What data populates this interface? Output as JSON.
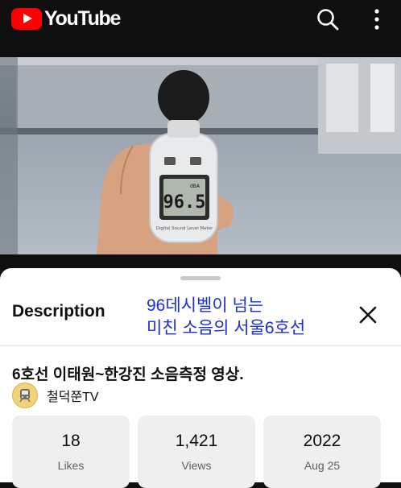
{
  "header": {
    "logo_text": "YouTube",
    "brand_color": "#ff0000",
    "search_icon": "search-icon",
    "menu_icon": "more-vert-icon"
  },
  "player": {
    "meter_reading": "96.5",
    "meter_unit": "dBA",
    "meter_brand": "Digital Sound Level Meter"
  },
  "description_panel": {
    "heading": "Description",
    "overlay_text_line1": "96데시벨이 넘는",
    "overlay_text_line2": "미친 소음의 서울6호선",
    "overlay_color": "#1a2fd8",
    "close_icon": "close-icon",
    "video_title": "6호선 이태원~한강진 소음측정 영상.",
    "channel_name": "철덕쭌TV",
    "stats": [
      {
        "value": "18",
        "label": "Likes"
      },
      {
        "value": "1,421",
        "label": "Views"
      },
      {
        "value": "2022",
        "label": "Aug 25"
      }
    ]
  }
}
